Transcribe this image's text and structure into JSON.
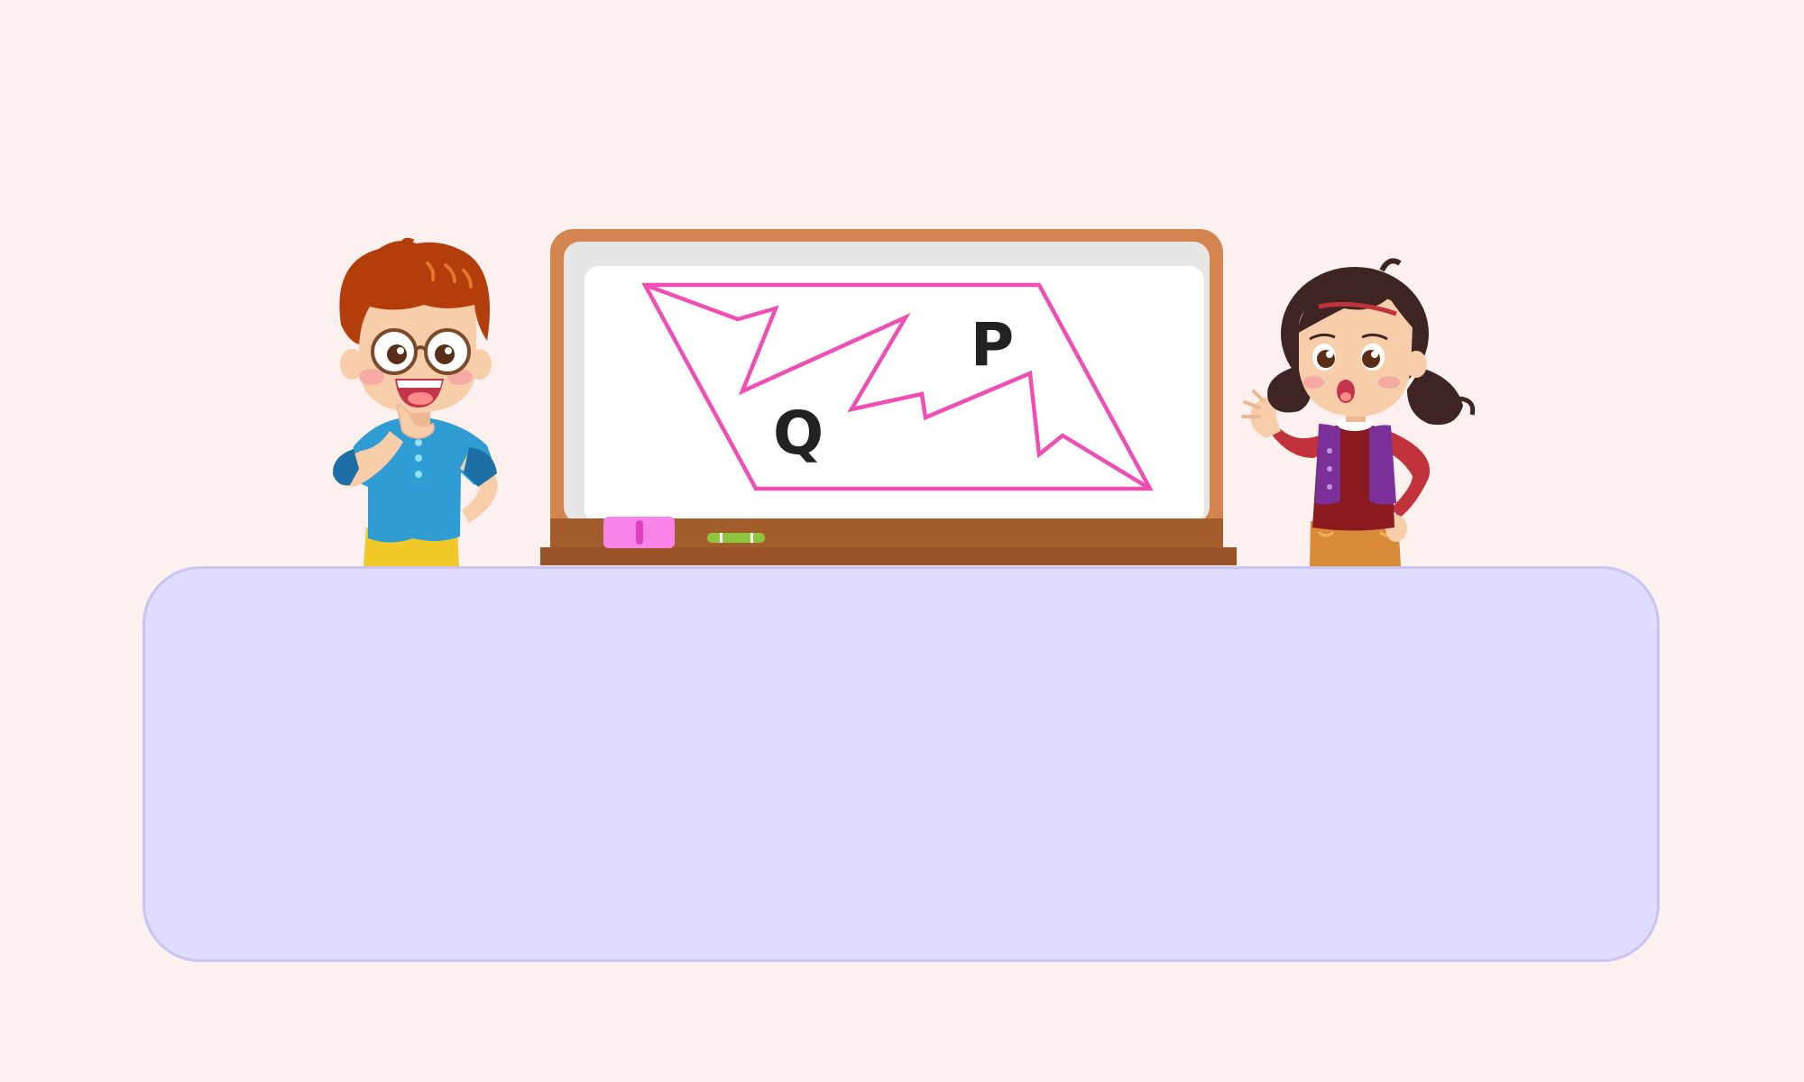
{
  "board": {
    "region_labels": {
      "q": "Q",
      "p": "P"
    },
    "shape_color": "#ef4fb4"
  },
  "colors": {
    "background": "#fdf1ef",
    "panel": "#dfdcfd",
    "board_frame": "#d3844f",
    "board_ledge": "#9a5326"
  },
  "characters": {
    "boy": "boy-thinking",
    "girl": "girl-surprised"
  },
  "info_box": {
    "text": ""
  }
}
